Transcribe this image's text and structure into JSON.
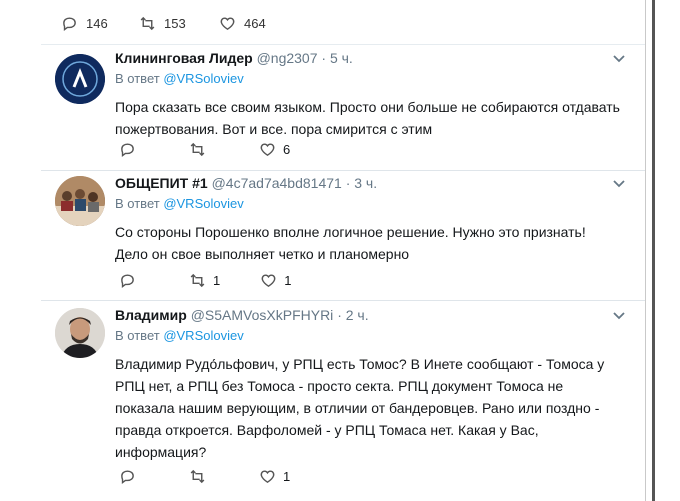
{
  "top_actions": {
    "replies": "146",
    "retweets": "153",
    "likes": "464"
  },
  "tweets": [
    {
      "name": "Клининговая Лидер",
      "handle": "@ng2307",
      "time": "· 5 ч.",
      "reply_prefix": "В ответ ",
      "reply_mention": "@VRSoloviev",
      "text": "Пора сказать все своим языком. Просто они больше не собираются отдавать\nпожертвования. Вот и все. пора смирится с этим",
      "replies": "",
      "retweets": "",
      "likes": "6"
    },
    {
      "name": "ОБЩЕПИТ #1",
      "handle": "@4c7ad7a4bd81471",
      "time": "· 3 ч.",
      "reply_prefix": "В ответ ",
      "reply_mention": "@VRSoloviev",
      "text": "Со стороны Порошенко вполне логичное решение. Нужно это признать!\nДело он свое выполняет четко и планомерно",
      "replies": "",
      "retweets": "1",
      "likes": "1"
    },
    {
      "name": "Владимир",
      "handle": "@S5AMVosXkPFHYRi",
      "time": "· 2 ч.",
      "reply_prefix": "В ответ ",
      "reply_mention": "@VRSoloviev",
      "text": "Владимир Рудо́льфович, у РПЦ есть Томос? В Инете сообщают - Томоса у\nРПЦ нет, а  РПЦ без Томоса - просто секта. РПЦ документ Томоса не\nпоказала нашим верующим, в отличии от бандеровцев. Рано или поздно -\nправда откроется. Варфоломей - у РПЦ Томаса нет. Какая у Вас,\nинформация?",
      "replies": "",
      "retweets": "",
      "likes": "1"
    }
  ],
  "colors": {
    "link": "#1b95e0",
    "muted": "#657786",
    "divider": "#e6ecf0",
    "avatar1": "#0f2a5e"
  },
  "icons": [
    "reply-icon",
    "retweet-icon",
    "like-icon",
    "chevron-down-icon"
  ]
}
